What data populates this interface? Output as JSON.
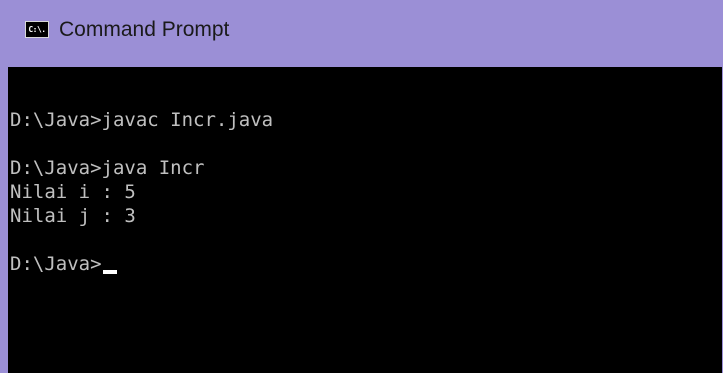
{
  "window": {
    "title": "Command Prompt",
    "icon_label": "C:\\."
  },
  "console": {
    "lines": [
      "D:\\Java>javac Incr.java",
      "",
      "D:\\Java>java Incr",
      "Nilai i : 5",
      "Nilai j : 3",
      "",
      "D:\\Java>"
    ],
    "cursor": "underscore"
  },
  "colors": {
    "titlebar": "#9b8fd6",
    "console_bg": "#000000",
    "console_text": "#c0c0c0"
  }
}
